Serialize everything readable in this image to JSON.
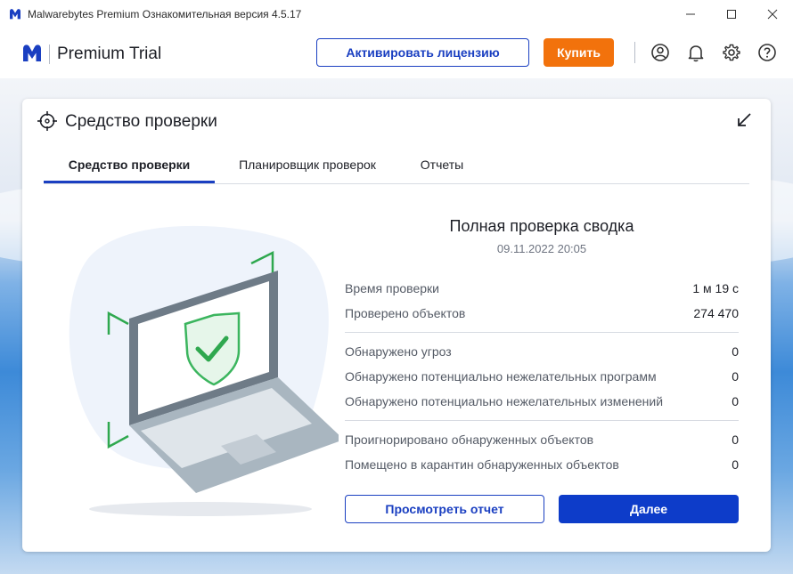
{
  "window": {
    "title": "Malwarebytes Premium Ознакомительная версия  4.5.17"
  },
  "header": {
    "brand": "Premium Trial",
    "activate_label": "Активировать лицензию",
    "buy_label": "Купить"
  },
  "card": {
    "title": "Средство проверки",
    "tabs": [
      {
        "label": "Средство проверки",
        "active": true
      },
      {
        "label": "Планировщик проверок",
        "active": false
      },
      {
        "label": "Отчеты",
        "active": false
      }
    ]
  },
  "summary": {
    "title": "Полная проверка сводка",
    "date": "09.11.2022 20:05",
    "stats": [
      {
        "label": "Время проверки",
        "value": "1 м 19 с"
      },
      {
        "label": "Проверено объектов",
        "value": "274 470"
      },
      {
        "label": "Обнаружено угроз",
        "value": "0"
      },
      {
        "label": "Обнаружено потенциально нежелательных программ",
        "value": "0"
      },
      {
        "label": "Обнаружено потенциально нежелательных изменений",
        "value": "0"
      },
      {
        "label": "Проигнорировано обнаруженных объектов",
        "value": "0"
      },
      {
        "label": "Помещено в карантин обнаруженных объектов",
        "value": "0"
      }
    ],
    "view_report_label": "Просмотреть отчет",
    "next_label": "Далее"
  },
  "colors": {
    "accent": "#1a3fc1",
    "buy": "#f2720c",
    "shield": "#3bb55e"
  }
}
